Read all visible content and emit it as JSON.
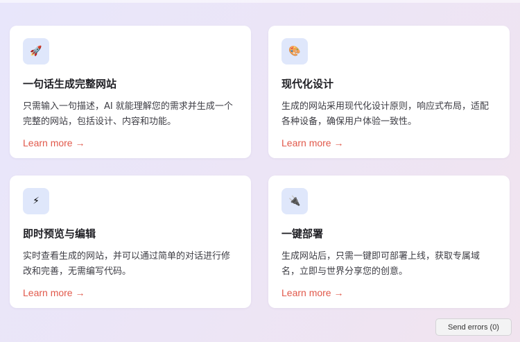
{
  "cards": [
    {
      "icon": "rocket-icon",
      "glyph": "🚀",
      "title": "一句话生成完整网站",
      "description": "只需输入一句描述，AI 就能理解您的需求并生成一个完整的网站，包括设计、内容和功能。",
      "link": "Learn more →"
    },
    {
      "icon": "palette-icon",
      "glyph": "🎨",
      "title": "现代化设计",
      "description": "生成的网站采用现代化设计原则，响应式布局，适配各种设备，确保用户体验一致性。",
      "link": "Learn more →"
    },
    {
      "icon": "lightning-icon",
      "glyph": "⚡",
      "title": "即时预览与编辑",
      "description": "实时查看生成的网站，并可以通过简单的对话进行修改和完善，无需编写代码。",
      "link": "Learn more →"
    },
    {
      "icon": "plug-icon",
      "glyph": "🔌",
      "title": "一键部署",
      "description": "生成网站后，只需一键即可部署上线，获取专属域名，立即与世界分享您的创意。",
      "link": "Learn more →"
    }
  ],
  "send_errors": "Send errors (0)",
  "colors": {
    "accent": "#e1584a",
    "icon_bg": "#dfe7fb"
  }
}
